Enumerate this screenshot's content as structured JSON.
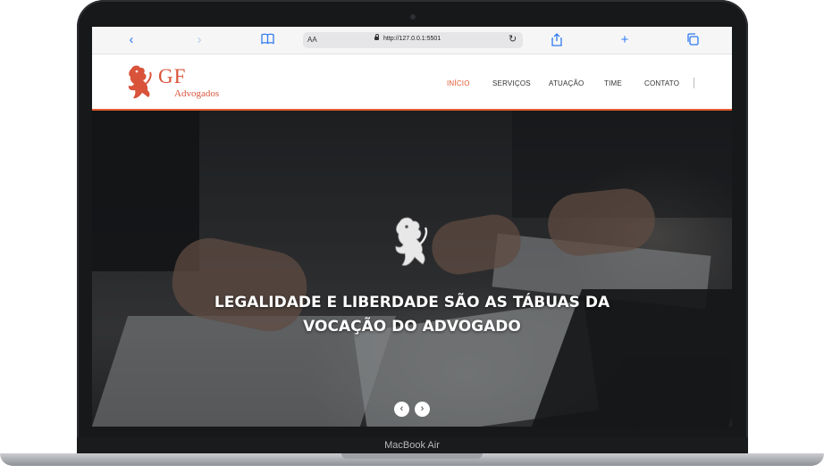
{
  "device": {
    "model_label": "MacBook Air"
  },
  "browser": {
    "text_size_label": "AA",
    "url": "http://127.0.0.1:5501",
    "icons": [
      "back-icon",
      "forward-icon",
      "bookmarks-icon",
      "lock-icon",
      "reload-icon",
      "share-icon",
      "new-tab-icon",
      "tabs-icon"
    ]
  },
  "site": {
    "logo": {
      "mark": "GF",
      "subtitle": "Advogados"
    },
    "nav": [
      {
        "label": "INÍCIO",
        "active": true
      },
      {
        "label": "SERVIÇOS",
        "active": false
      },
      {
        "label": "ATUAÇÃO",
        "active": false
      },
      {
        "label": "TIME",
        "active": false
      },
      {
        "label": "CONTATO",
        "active": false
      }
    ],
    "hero": {
      "headline": "LEGALIDADE E LIBERDADE SÃO AS TÁBUAS DA VOCAÇÃO DO ADVOGADO",
      "prev_glyph": "‹",
      "next_glyph": "›"
    }
  },
  "colors": {
    "accent": "#e55a32",
    "logo": "#d9533a",
    "browser_blue": "#2f7af0"
  }
}
